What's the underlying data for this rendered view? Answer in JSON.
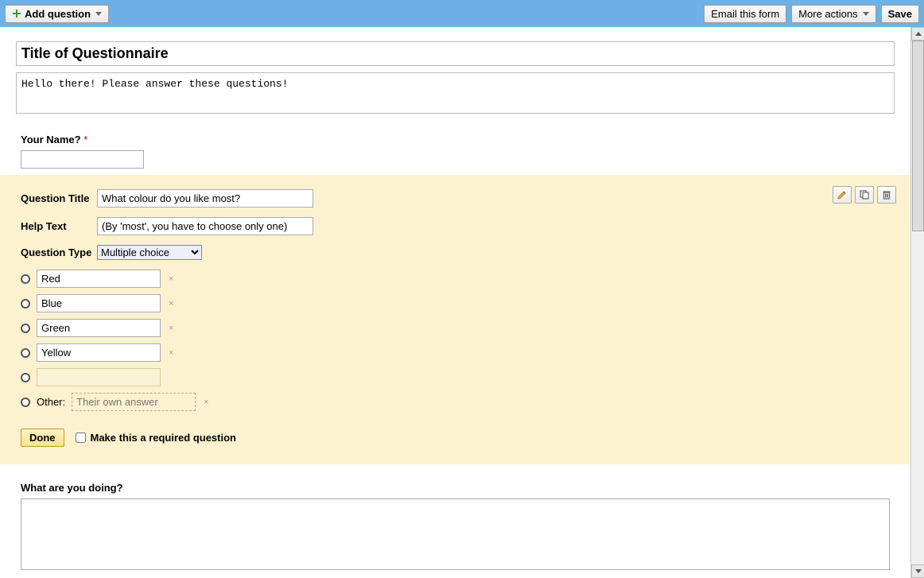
{
  "toolbar": {
    "add_question": "Add question",
    "email_form": "Email this form",
    "more_actions": "More actions",
    "save": "Save"
  },
  "form": {
    "title": "Title of Questionnaire",
    "description": "Hello there! Please answer these questions!"
  },
  "question1": {
    "label": "Your Name?",
    "required_marker": "*",
    "value": ""
  },
  "editor": {
    "fields": {
      "title_label": "Question Title",
      "help_label": "Help Text",
      "type_label": "Question Type"
    },
    "title_value": "What colour do you like most?",
    "help_value": "(By 'most', you have to choose only one)",
    "type_value": "Multiple choice",
    "options": [
      "Red",
      "Blue",
      "Green",
      "Yellow"
    ],
    "new_option_value": "",
    "other_label": "Other:",
    "other_placeholder": "Their own answer",
    "done_label": "Done",
    "required_label": "Make this a required question"
  },
  "question3": {
    "label": "What are you doing?",
    "value": ""
  },
  "icons": {
    "edit": "pencil-icon",
    "duplicate": "duplicate-icon",
    "delete": "trash-icon",
    "remove_option": "×"
  }
}
